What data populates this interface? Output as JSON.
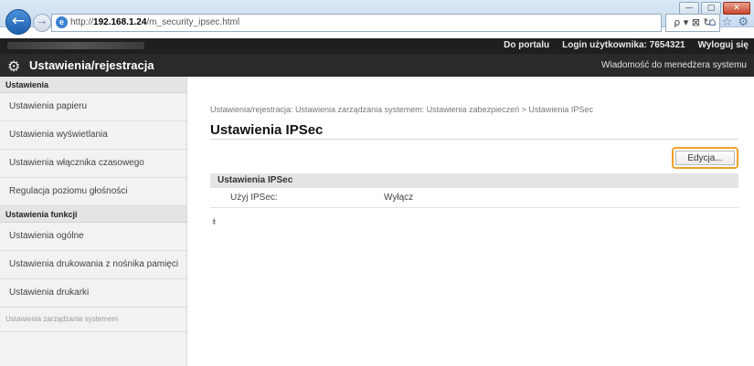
{
  "browser": {
    "address_prefix": "http://",
    "address_host": "192.168.1.24",
    "address_path": "/m_security_ipsec.html",
    "address_tools": "ρ ▾ ⊠ ↻",
    "window_controls": [
      "—",
      "▢",
      "✕"
    ]
  },
  "topbar": {
    "portal_link": "Do portalu",
    "login_label": "Login użytkownika:",
    "login_value": "7654321",
    "logout_link": "Wyloguj się"
  },
  "appbar": {
    "title": "Ustawienia/rejestracja",
    "message_link": "Wiadomość do menedżera systemu"
  },
  "sidebar": {
    "section1": "Ustawienia",
    "items1": [
      "Ustawienia papieru",
      "Ustawienia wyświetlania",
      "Ustawienia włącznika czasowego",
      "Regulacja poziomu głośności"
    ],
    "section2": "Ustawienia funkcji",
    "items2": [
      "Ustawienia ogólne",
      "Ustawienia drukowania z nośnika pamięci",
      "Ustawienia drukarki"
    ],
    "section3": "Ustawienia zarządzania systemem"
  },
  "main": {
    "breadcrumb": "Ustawienia/rejestracja: Ustawienia zarządzania systemem: Ustawienia zabezpieczeń > Ustawienia IPSec",
    "title": "Ustawienia IPSec",
    "edit_button": "Edycja...",
    "section_title": "Ustawienia IPSec",
    "row_label": "Użyj IPSec:",
    "row_value": "Wyłącz",
    "top_icon": "⯒"
  }
}
